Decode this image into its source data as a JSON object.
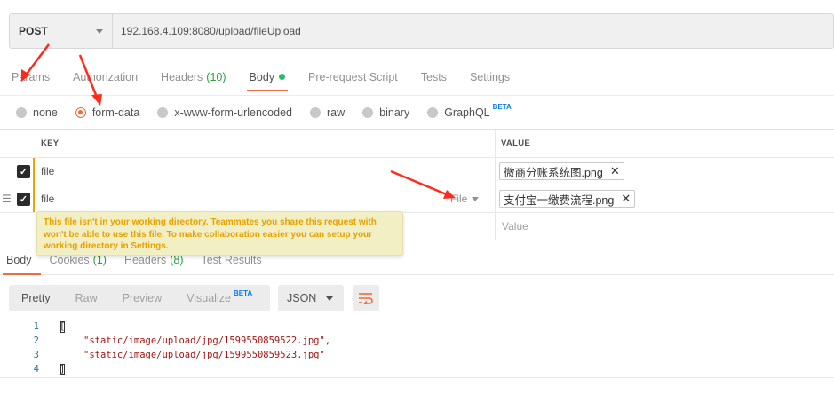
{
  "request": {
    "method": "POST",
    "url": "192.168.4.109:8080/upload/fileUpload"
  },
  "req_tabs": [
    {
      "label": "Params"
    },
    {
      "label": "Authorization"
    },
    {
      "label": "Headers",
      "count": "(10)"
    },
    {
      "label": "Body"
    },
    {
      "label": "Pre-request Script"
    },
    {
      "label": "Tests"
    },
    {
      "label": "Settings"
    }
  ],
  "body_types": {
    "none": "none",
    "form_data": "form-data",
    "urlencoded": "x-www-form-urlencoded",
    "raw": "raw",
    "binary": "binary",
    "graphql": "GraphQL",
    "beta": "BETA"
  },
  "table": {
    "key_header": "KEY",
    "value_header": "VALUE",
    "rows": [
      {
        "key": "file",
        "value": "微商分账系统图.png"
      },
      {
        "key": "file",
        "type": "File",
        "value": "支付宝一缴费流程.png"
      }
    ],
    "value_placeholder": "Value"
  },
  "tooltip": "This file isn't in your working directory. Teammates you share this request with won't be able to use this file. To make collaboration easier you can setup your working directory in Settings.",
  "resp_tabs": [
    {
      "label": "Body"
    },
    {
      "label": "Cookies",
      "count": "(1)"
    },
    {
      "label": "Headers",
      "count": "(8)"
    },
    {
      "label": "Test Results"
    }
  ],
  "view_modes": {
    "pretty": "Pretty",
    "raw": "Raw",
    "preview": "Preview",
    "visualize": "Visualize",
    "beta": "BETA"
  },
  "format": "JSON",
  "code": {
    "lines": [
      {
        "n": "1",
        "text": "["
      },
      {
        "n": "2",
        "text": "\"static/image/upload/jpg/1599550859522.jpg\","
      },
      {
        "n": "3",
        "text": "\"static/image/upload/jpg/1599550859523.jpg\""
      },
      {
        "n": "4",
        "text": "]"
      }
    ]
  },
  "colors": {
    "accent": "#f26b3a",
    "count_green": "#2e9e44",
    "body_dot": "#2eb764",
    "beta_blue": "#097bed",
    "annotation_red": "#ff2a1a",
    "tooltip_text": "#e6a100"
  }
}
